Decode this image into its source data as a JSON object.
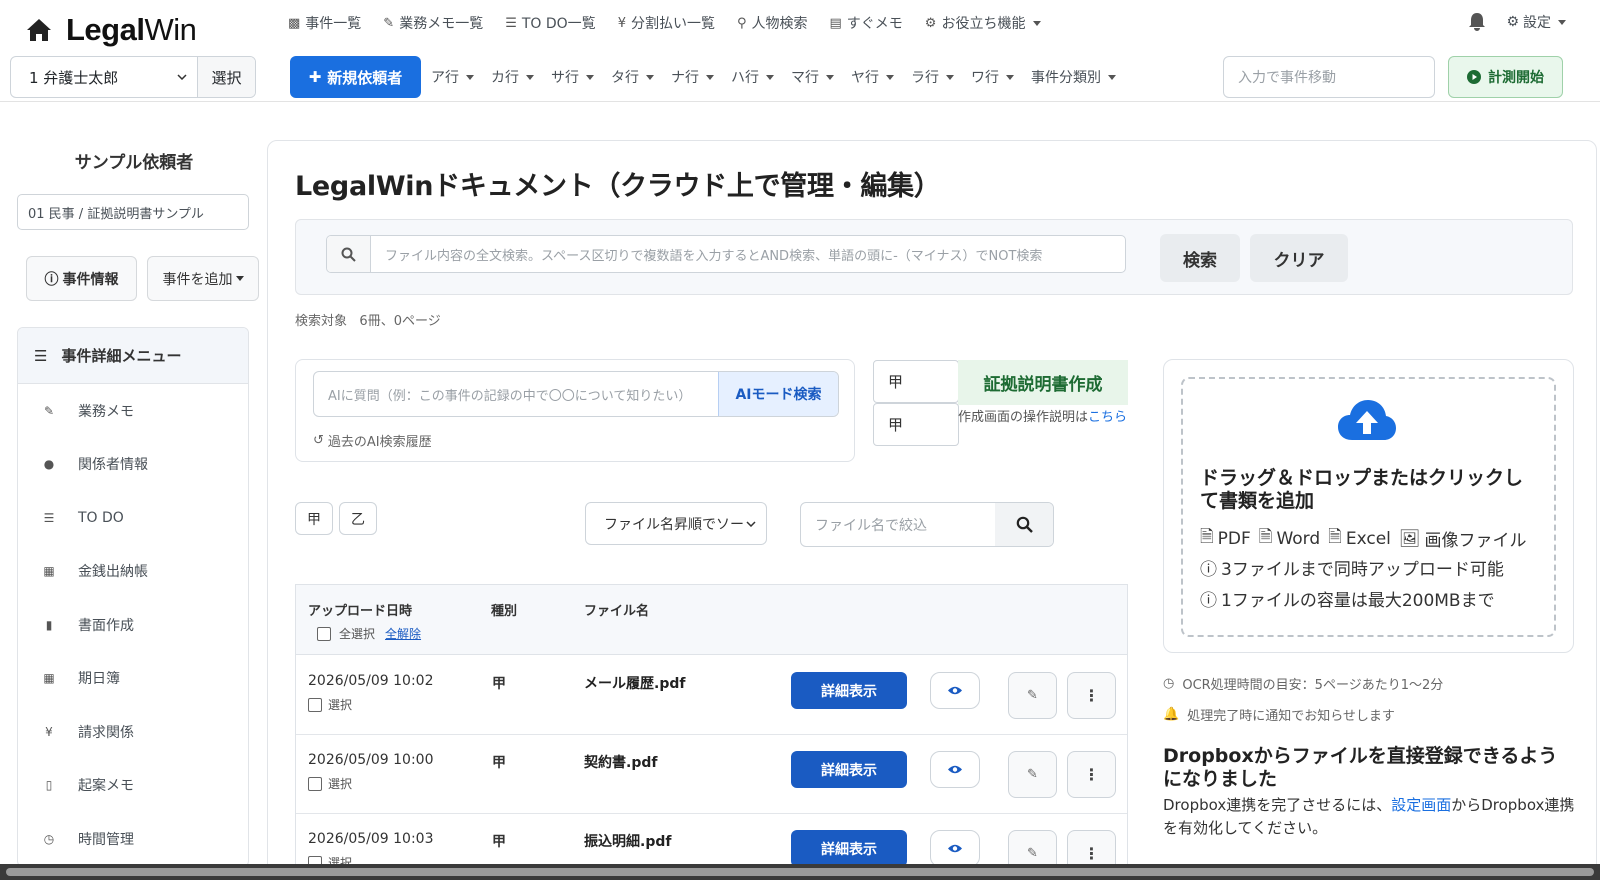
{
  "app": {
    "logo_bold": "Legal",
    "logo_thin": "Win"
  },
  "topmenu": [
    {
      "icon": "briefcase-icon",
      "label": "事件一覧"
    },
    {
      "icon": "pencil-icon",
      "label": "業務メモ一覧"
    },
    {
      "icon": "list-icon",
      "label": "TO DO一覧"
    },
    {
      "icon": "yen-icon",
      "label": "分割払い一覧"
    },
    {
      "icon": "search-icon",
      "label": "人物検索"
    },
    {
      "icon": "file-icon",
      "label": "すぐメモ"
    },
    {
      "icon": "gear-icon",
      "label": "お役立ち機能"
    }
  ],
  "settings_label": "設定",
  "lawyer_select": {
    "value": "1 弁護士太郎",
    "button": "選択"
  },
  "new_client_label": "新規依頼者",
  "kana_tabs": [
    "ア行",
    "カ行",
    "サ行",
    "タ行",
    "ナ行",
    "ハ行",
    "マ行",
    "ヤ行",
    "ラ行",
    "ワ行",
    "事件分類別"
  ],
  "jump_placeholder": "入力で事件移動",
  "timer_label": "計測開始",
  "sidebar": {
    "client_name": "サンプル依頼者",
    "case_label": "01 民事 / 証拠説明書サンプル",
    "case_info_button": "事件情報",
    "add_case_button": "事件を追加",
    "menu_title": "事件詳細メニュー",
    "items": [
      {
        "icon": "pencil-icon",
        "label": "業務メモ"
      },
      {
        "icon": "user-icon",
        "label": "関係者情報"
      },
      {
        "icon": "list-icon",
        "label": "TO DO"
      },
      {
        "icon": "calculator-icon",
        "label": "金銭出納帳"
      },
      {
        "icon": "file-icon",
        "label": "書面作成"
      },
      {
        "icon": "calendar-icon",
        "label": "期日簿"
      },
      {
        "icon": "yen-icon",
        "label": "請求関係"
      },
      {
        "icon": "book-icon",
        "label": "起案メモ"
      },
      {
        "icon": "clock-icon",
        "label": "時間管理"
      }
    ]
  },
  "main": {
    "title": "LegalWinドキュメント（クラウド上で管理・編集）",
    "search_placeholder": "ファイル内容の全文検索。スペース区切りで複数語を入力するとAND検索、単語の頭に-（マイナス）でNOT検索",
    "search_button": "検索",
    "clear_button": "クリア",
    "search_target_label": "検索対象",
    "search_target_value": "6冊、0ページ",
    "ai_placeholder": "AIに質問（例：この事件の記録の中で〇〇について知りたい）",
    "ai_button": "AIモード検索",
    "ai_history": "過去のAI検索履歴",
    "party_select_1": "甲",
    "party_select_2": "甲",
    "evidence_button": "証拠説明書作成",
    "evidence_help": "作成画面の操作説明は",
    "evidence_help_link": "こちら",
    "tag_buttons": [
      "甲",
      "乙"
    ],
    "sort_value": "ファイル名昇順でソート",
    "filter_placeholder": "ファイル名で絞込",
    "table": {
      "headers": {
        "uploaded": "アップロード日時",
        "kind": "種別",
        "filename": "ファイル名"
      },
      "select_all": "全選択",
      "clear_all": "全解除",
      "select_label": "選択",
      "detail_button": "詳細表示",
      "rows": [
        {
          "datetime": "2026/05/09 10:02",
          "kind": "甲",
          "filename": "メール履歴.pdf"
        },
        {
          "datetime": "2026/05/09 10:00",
          "kind": "甲",
          "filename": "契約書.pdf"
        },
        {
          "datetime": "2026/05/09 10:03",
          "kind": "甲",
          "filename": "振込明細.pdf"
        }
      ]
    }
  },
  "upload": {
    "title": "ドラッグ＆ドロップまたはクリックして書類を追加",
    "types": [
      "PDF",
      "Word",
      "Excel",
      "画像ファイル"
    ],
    "limit_files": "3ファイルまで同時アップロード可能",
    "limit_size": "1ファイルの容量は最大200MBまで",
    "ocr_note": "OCR処理時間の目安：5ページあたり1〜2分",
    "notify_note": "処理完了時に通知でお知らせします",
    "dropbox_title": "Dropboxからファイルを直接登録できるようになりました",
    "dropbox_text_1": "Dropbox連携を完了させるには、",
    "dropbox_link": "設定画面",
    "dropbox_text_2": "からDropbox連携を有効化してください。"
  },
  "colors": {
    "primary": "#1a6fe0",
    "detail": "#1a5bc2",
    "success": "#1d6b33",
    "success_bg": "#e8f5ea"
  }
}
